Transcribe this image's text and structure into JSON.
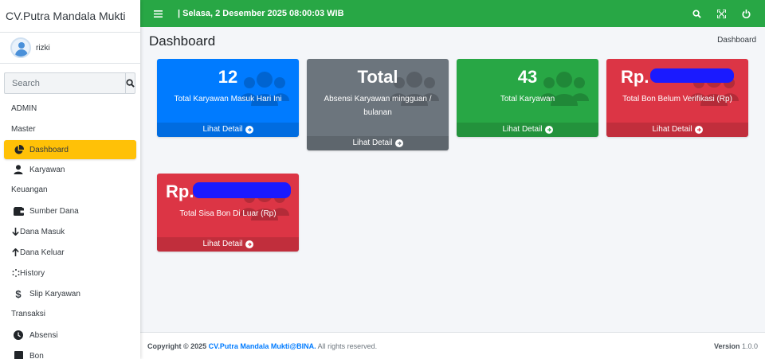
{
  "brand": {
    "title": "CV.Putra Mandala Mukti"
  },
  "user": {
    "name": "rizki"
  },
  "search": {
    "placeholder": "Search"
  },
  "sidebar": {
    "admin_header": "ADMIN",
    "master_header": "Master",
    "dashboard": "Dashboard",
    "karyawan": "Karyawan",
    "keuangan_header": "Keuangan",
    "sumber_dana": "Sumber Dana",
    "dana_masuk": "Dana Masuk",
    "dana_keluar": "Dana Keluar",
    "history": "History",
    "slip_karyawan": "Slip Karyawan",
    "transaksi_header": "Transaksi",
    "absensi": "Absensi",
    "bon": "Bon"
  },
  "topbar": {
    "datetime": "| Selasa, 2 Desember 2025 08:00:03 WIB"
  },
  "page": {
    "title": "Dashboard",
    "breadcrumb": "Dashboard"
  },
  "cards": {
    "c1": {
      "value": "12",
      "label": "Total Karyawan Masuk Hari Ini",
      "footer": "Lihat Detail",
      "color": "#007bff"
    },
    "c2": {
      "value": "Total",
      "label": "Absensi Karyawan mingguan / bulanan",
      "footer": "Lihat Detail",
      "color": "#6c757d"
    },
    "c3": {
      "value": "43",
      "label": "Total Karyawan",
      "footer": "Lihat Detail",
      "color": "#28a745"
    },
    "c4": {
      "value": "Rp.",
      "label": "Total Bon Belum Verifikasi (Rp)",
      "footer": "Lihat Detail",
      "color": "#dc3545"
    },
    "c5": {
      "value": "Rp.",
      "label": "Total Sisa Bon Di Luar (Rp)",
      "footer": "Lihat Detail",
      "color": "#dc3545"
    }
  },
  "footer": {
    "copyright": "Copyright © 2025",
    "company_link": "CV.Putra Mandala Mukti@BINA.",
    "rights": "All rights reserved.",
    "version_label": "Version",
    "version_value": "1.0.0"
  },
  "icons": {
    "menu": "menu-icon",
    "search": "search-icon",
    "expand": "expand-icon",
    "power": "power-icon",
    "dashboard": "pie-chart-icon",
    "karyawan": "user-icon",
    "sumber_dana": "wallet-icon",
    "dana_masuk": "arrow-down-icon",
    "dana_keluar": "arrow-up-icon",
    "history": "spinner-icon",
    "slip": "dollar-icon",
    "absensi": "clock-icon",
    "bon": "receipt-icon",
    "card_bg": "users-icon"
  }
}
